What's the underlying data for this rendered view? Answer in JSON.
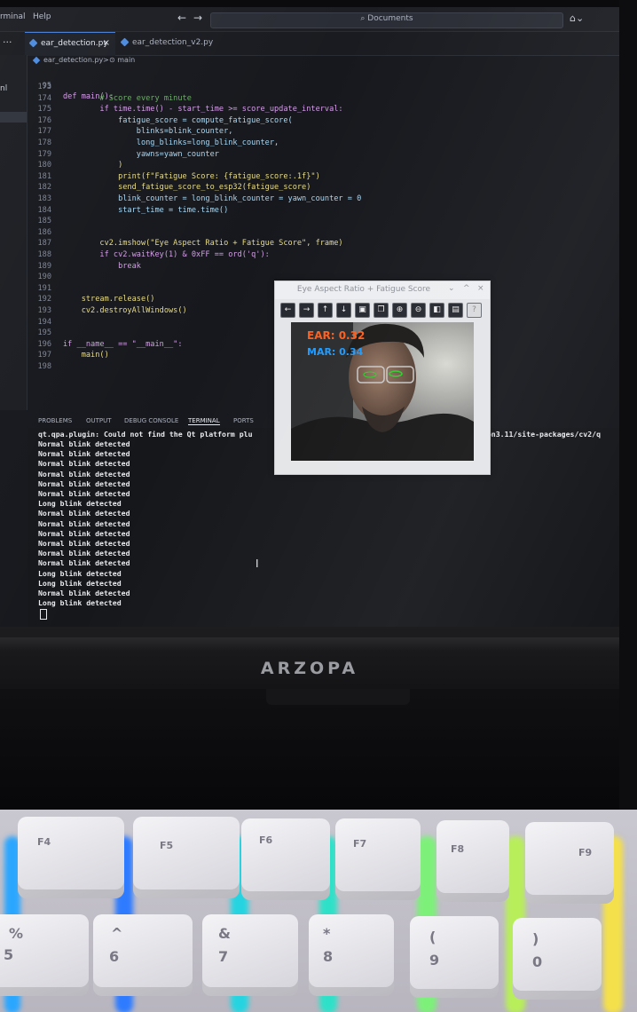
{
  "menu": {
    "terminal": "rminal",
    "help": "Help"
  },
  "nav": {
    "back": "←",
    "forward": "→"
  },
  "command_center": {
    "text": "⌕ Documents"
  },
  "tabs": [
    {
      "label": "ear_detection.py",
      "close": "×"
    },
    {
      "label": "ear_detection_v2.py"
    }
  ],
  "tab_more": "···",
  "breadcrumb": {
    "file": "ear_detection.py",
    "sep": ">",
    "symbol": "⊙ main"
  },
  "sidebar": {
    "label": "nl"
  },
  "sticky": {
    "ln": "95",
    "code": "def main():"
  },
  "code_lines": [
    {
      "ln": "173",
      "code": ""
    },
    {
      "ln": "174",
      "code": "        # Score every minute"
    },
    {
      "ln": "175",
      "code": "        if time.time() - start_time >= score_update_interval:"
    },
    {
      "ln": "176",
      "code": "            fatigue_score = compute_fatigue_score("
    },
    {
      "ln": "177",
      "code": "                blinks=blink_counter,"
    },
    {
      "ln": "178",
      "code": "                long_blinks=long_blink_counter,"
    },
    {
      "ln": "179",
      "code": "                yawns=yawn_counter"
    },
    {
      "ln": "180",
      "code": "            )"
    },
    {
      "ln": "181",
      "code": "            print(f\"Fatigue Score: {fatigue_score:.1f}\")"
    },
    {
      "ln": "182",
      "code": "            send_fatigue_score_to_esp32(fatigue_score)"
    },
    {
      "ln": "183",
      "code": "            blink_counter = long_blink_counter = yawn_counter = 0"
    },
    {
      "ln": "184",
      "code": "            start_time = time.time()"
    },
    {
      "ln": "185",
      "code": ""
    },
    {
      "ln": "186",
      "code": ""
    },
    {
      "ln": "187",
      "code": "        cv2.imshow(\"Eye Aspect Ratio + Fatigue Score\", frame)"
    },
    {
      "ln": "188",
      "code": "        if cv2.waitKey(1) & 0xFF == ord('q'):"
    },
    {
      "ln": "189",
      "code": "            break"
    },
    {
      "ln": "190",
      "code": ""
    },
    {
      "ln": "191",
      "code": ""
    },
    {
      "ln": "192",
      "code": "    stream.release()"
    },
    {
      "ln": "193",
      "code": "    cv2.destroyAllWindows()"
    },
    {
      "ln": "194",
      "code": ""
    },
    {
      "ln": "195",
      "code": ""
    },
    {
      "ln": "196",
      "code": "if __name__ == \"__main__\":"
    },
    {
      "ln": "197",
      "code": "    main()"
    },
    {
      "ln": "198",
      "code": ""
    }
  ],
  "panel_tabs": [
    "PROBLEMS",
    "OUTPUT",
    "DEBUG CONSOLE",
    "TERMINAL",
    "PORTS"
  ],
  "terminal_first_line": "qt.qpa.plugin: Could not find the Qt platform plu",
  "terminal_first_line_tail": "thon3.11/site-packages/cv2/q",
  "terminal_lines": [
    "Normal blink detected",
    "Normal blink detected",
    "Normal blink detected",
    "Normal blink detected",
    "Normal blink detected",
    "Normal blink detected",
    "Long blink detected",
    "Normal blink detected",
    "Normal blink detected",
    "Normal blink detected",
    "Normal blink detected",
    "Normal blink detected",
    "Normal blink detected",
    "Long blink detected",
    "Long blink detected",
    "Normal blink detected",
    "Long blink detected"
  ],
  "cv_window": {
    "title": "Eye Aspect Ratio + Fatigue Score",
    "controls": [
      "⌄",
      "^",
      "×"
    ],
    "ear_text": "EAR: 0.32",
    "mar_text": "MAR: 0.34",
    "toolbar_icons": [
      "arrow-left-icon",
      "arrow-right-icon",
      "arrow-up-icon",
      "arrow-down-icon",
      "save-icon",
      "copy-icon",
      "zoom-in-icon",
      "zoom-out-icon",
      "zoom-fit-icon",
      "properties-icon",
      "help-icon"
    ]
  },
  "monitor_brand": "ARZOPA",
  "keys_top": [
    "F4",
    "F5",
    "F6",
    "F7",
    "F8",
    "F9"
  ],
  "keys_bottom": [
    {
      "shift": "%",
      "main": "5"
    },
    {
      "shift": "^",
      "main": "6"
    },
    {
      "shift": "&",
      "main": "7"
    },
    {
      "shift": "*",
      "main": "8"
    },
    {
      "shift": "(",
      "main": "9"
    },
    {
      "shift": ")",
      "main": "0"
    }
  ],
  "colors": {
    "editor_bg": "#16181d",
    "ear_label": "#ff5e1a",
    "mar_label": "#1e9bff",
    "keyword": "#d59ee8",
    "function": "#e8dc86"
  }
}
